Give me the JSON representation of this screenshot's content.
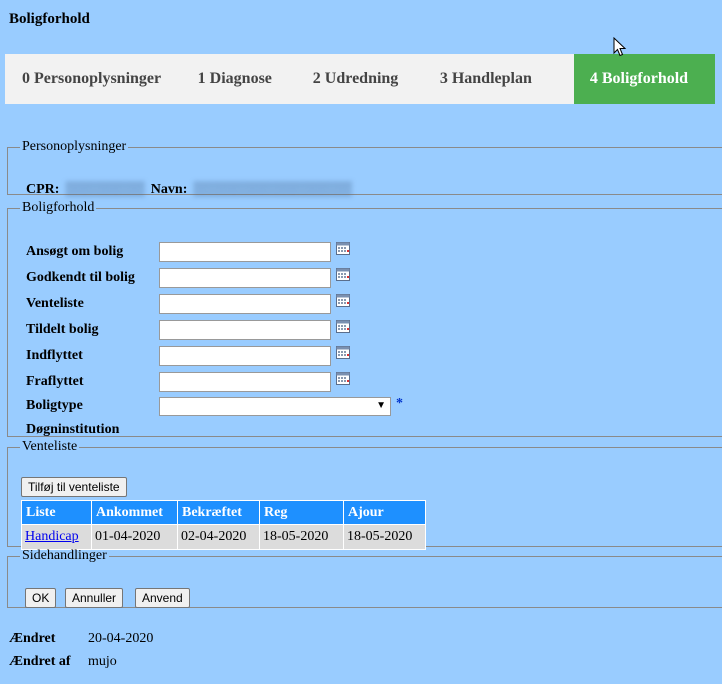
{
  "page_title": "Boligforhold",
  "tabs": [
    {
      "label": "0 Personoplysninger",
      "active": false
    },
    {
      "label": "1 Diagnose",
      "active": false
    },
    {
      "label": "2 Udredning",
      "active": false
    },
    {
      "label": "3 Handleplan",
      "active": false
    },
    {
      "label": "4 Boligforhold",
      "active": true
    }
  ],
  "personoplysninger": {
    "legend": "Personoplysninger",
    "cpr_label": "CPR:",
    "navn_label": "Navn:"
  },
  "boligforhold": {
    "legend": "Boligforhold",
    "fields": [
      {
        "label": "Ansøgt om bolig",
        "value": ""
      },
      {
        "label": "Godkendt til bolig",
        "value": ""
      },
      {
        "label": "Venteliste",
        "value": ""
      },
      {
        "label": "Tildelt bolig",
        "value": ""
      },
      {
        "label": "Indflyttet",
        "value": ""
      },
      {
        "label": "Fraflyttet",
        "value": ""
      }
    ],
    "boligtype_label": "Boligtype",
    "boligtype_value": "",
    "required_marker": "*",
    "dognInstitution_label": "Døgninstitution"
  },
  "venteliste": {
    "legend": "Venteliste",
    "add_button": "Tilføj til venteliste",
    "headers": [
      "Liste",
      "Ankommet",
      "Bekræftet",
      "Reg",
      "Ajour"
    ],
    "rows": [
      {
        "liste": "Handicap",
        "ankommet": "01-04-2020",
        "bekraeftet": "02-04-2020",
        "reg": "18-05-2020",
        "ajour": "18-05-2020"
      }
    ]
  },
  "sidehandlinger": {
    "legend": "Sidehandlinger",
    "ok": "OK",
    "cancel": "Annuller",
    "apply": "Anvend"
  },
  "meta": {
    "changed_label": "Ændret",
    "changed_value": "20-04-2020",
    "changed_by_label": "Ændret af",
    "changed_by_value": "mujo"
  },
  "colors": {
    "background": "#99ccff",
    "active_tab": "#4caf50",
    "table_header": "#1e90ff"
  }
}
